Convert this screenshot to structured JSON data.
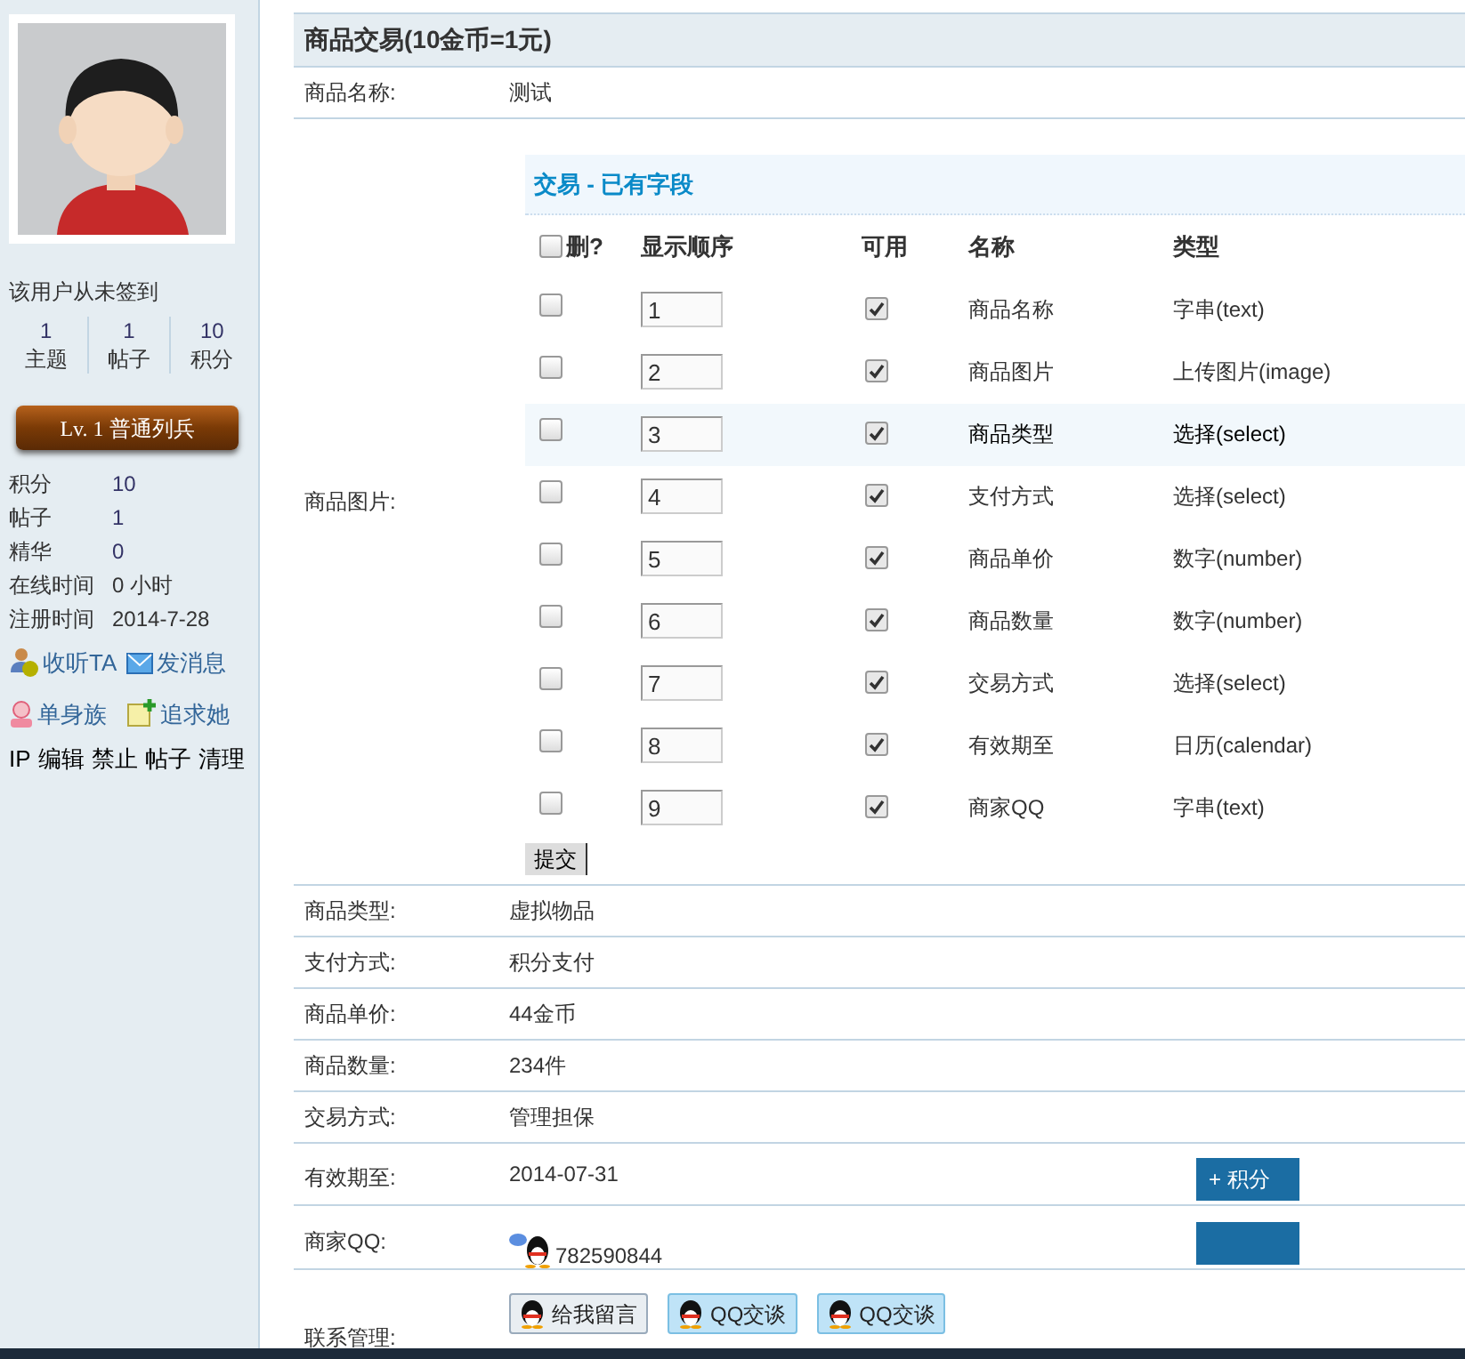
{
  "sidebar": {
    "signin_status": "该用户从未签到",
    "stats": [
      {
        "value": "1",
        "label": "主题"
      },
      {
        "value": "1",
        "label": "帖子"
      },
      {
        "value": "10",
        "label": "积分"
      }
    ],
    "level_badge": "Lv. 1 普通列兵",
    "info": [
      {
        "label": "积分",
        "value": "10",
        "kind": "link"
      },
      {
        "label": "帖子",
        "value": "1",
        "kind": "link"
      },
      {
        "label": "精华",
        "value": "0",
        "kind": "link"
      },
      {
        "label": "在线时间",
        "value": "0 小时",
        "kind": "plain"
      },
      {
        "label": "注册时间",
        "value": "2014-7-28",
        "kind": "plain"
      }
    ],
    "actions": [
      {
        "label": "收听TA",
        "kind": "follow"
      },
      {
        "label": "发消息",
        "kind": "message"
      },
      {
        "label": "单身族",
        "kind": "single"
      },
      {
        "label": "追求她",
        "kind": "pursue"
      }
    ],
    "admin_links": [
      "IP",
      "编辑",
      "禁止",
      "帖子",
      "清理"
    ]
  },
  "section_title": "商品交易(10金币=1元)",
  "fields": [
    {
      "kind": "text",
      "label": "商品名称:",
      "value": "测试"
    },
    {
      "kind": "field_table",
      "label": "商品图片:",
      "table": {
        "title": "交易 - 已有字段",
        "select_all_checked": false,
        "columns": [
          "删?",
          "显示顺序",
          "可用",
          "名称",
          "类型"
        ],
        "rows": [
          {
            "delete_checked": false,
            "order": "1",
            "enabled": true,
            "name": "商品名称",
            "type": "字串(text)",
            "selected": false
          },
          {
            "delete_checked": false,
            "order": "2",
            "enabled": true,
            "name": "商品图片",
            "type": "上传图片(image)",
            "selected": false
          },
          {
            "delete_checked": false,
            "order": "3",
            "enabled": true,
            "name": "商品类型",
            "type": "选择(select)",
            "selected": true
          },
          {
            "delete_checked": false,
            "order": "4",
            "enabled": true,
            "name": "支付方式",
            "type": "选择(select)",
            "selected": false
          },
          {
            "delete_checked": false,
            "order": "5",
            "enabled": true,
            "name": "商品单价",
            "type": "数字(number)",
            "selected": false
          },
          {
            "delete_checked": false,
            "order": "6",
            "enabled": true,
            "name": "商品数量",
            "type": "数字(number)",
            "selected": false
          },
          {
            "delete_checked": false,
            "order": "7",
            "enabled": true,
            "name": "交易方式",
            "type": "选择(select)",
            "selected": false
          },
          {
            "delete_checked": false,
            "order": "8",
            "enabled": true,
            "name": "有效期至",
            "type": "日历(calendar)",
            "selected": false
          },
          {
            "delete_checked": false,
            "order": "9",
            "enabled": true,
            "name": "商家QQ",
            "type": "字串(text)",
            "selected": false
          }
        ],
        "submit": "提交"
      }
    },
    {
      "kind": "text",
      "label": "商品类型:",
      "value": "虚拟物品"
    },
    {
      "kind": "text",
      "label": "支付方式:",
      "value": "积分支付"
    },
    {
      "kind": "text",
      "label": "商品单价:",
      "value": "44金币"
    },
    {
      "kind": "text",
      "label": "商品数量:",
      "value": "234件"
    },
    {
      "kind": "text",
      "label": "交易方式:",
      "value": "管理担保"
    },
    {
      "kind": "tall",
      "label": "有效期至:",
      "value": "2014-07-31"
    },
    {
      "kind": "qq",
      "label": "商家QQ:",
      "value": "782590844"
    },
    {
      "kind": "contact",
      "label": "联系管理:",
      "buttons": [
        {
          "label": "给我留言",
          "kind": "message"
        },
        {
          "label": "QQ交谈",
          "kind": "qq"
        },
        {
          "label": "QQ交谈",
          "kind": "qq"
        }
      ]
    }
  ],
  "float_buttons": [
    {
      "label": "+ 积分"
    }
  ]
}
